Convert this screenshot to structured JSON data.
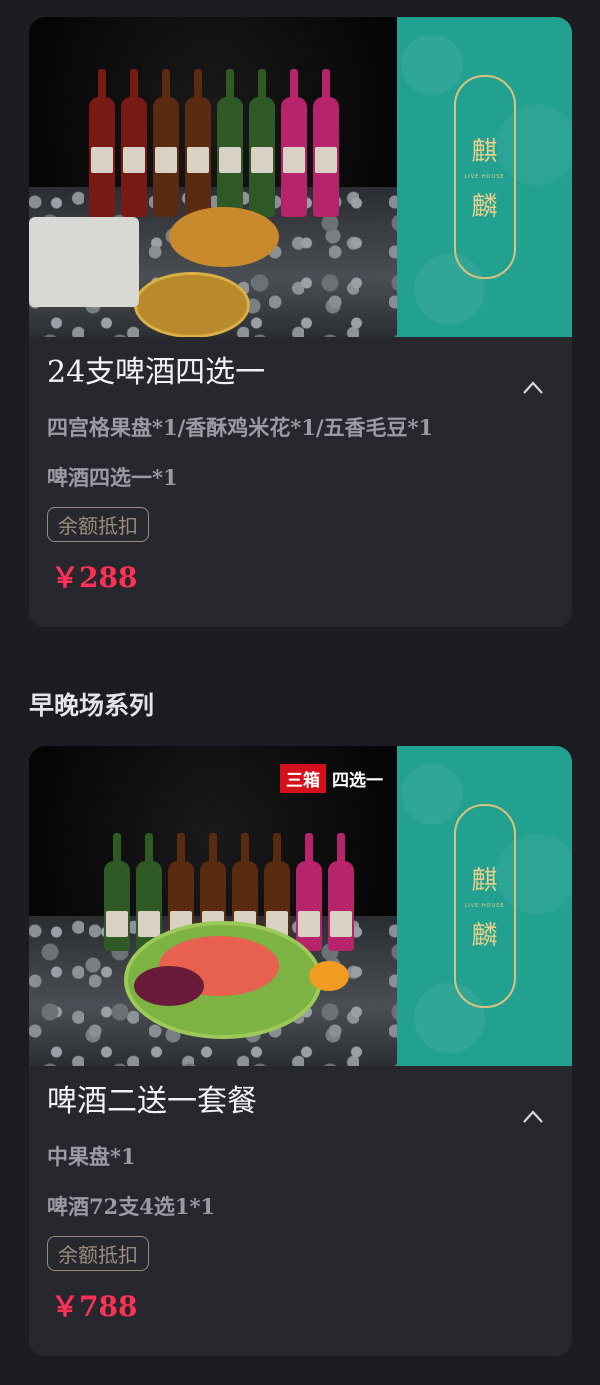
{
  "sections": {
    "early_late_title": "早晚场系列"
  },
  "cards": [
    {
      "title": "24支啤酒四选一",
      "items": [
        "四宫格果盘*1/香酥鸡米花*1/五香毛豆*1",
        "啤酒四选一*1"
      ],
      "tag": "余额抵扣",
      "price": "￥288",
      "brand_chars": [
        "麒",
        "麟"
      ]
    },
    {
      "title": "啤酒二送一套餐",
      "items": [
        "中果盘*1",
        "啤酒72支4选1*1"
      ],
      "tag": "余额抵扣",
      "price": "￥788",
      "badge_red": "三箱",
      "badge_white": "四选一",
      "brand_chars": [
        "麒",
        "麟"
      ]
    }
  ],
  "colors": {
    "background": "#1c1c22",
    "card": "#27272e",
    "price": "#ff3156",
    "brand_panel": "#22a090"
  },
  "icons": {
    "collapse": "chevron-up-icon"
  }
}
